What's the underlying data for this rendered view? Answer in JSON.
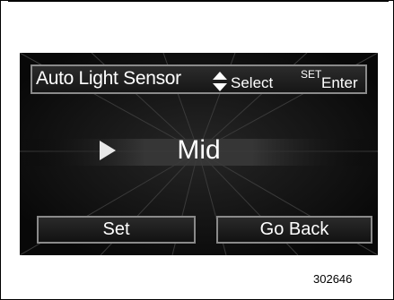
{
  "header": {
    "title": "Auto Light Sensor",
    "select_icon": "up-down-arrows-icon",
    "select_label": "Select",
    "set_key_label": "SET",
    "enter_label": "Enter"
  },
  "setting": {
    "indicator_icon": "triangle-right-icon",
    "value": "Mid"
  },
  "buttons": {
    "set_label": "Set",
    "back_label": "Go Back"
  },
  "figure_number": "302646",
  "colors": {
    "screen_bg": "#0a0a0a",
    "border_gray": "#8a8a8a",
    "text": "#ffffff"
  }
}
